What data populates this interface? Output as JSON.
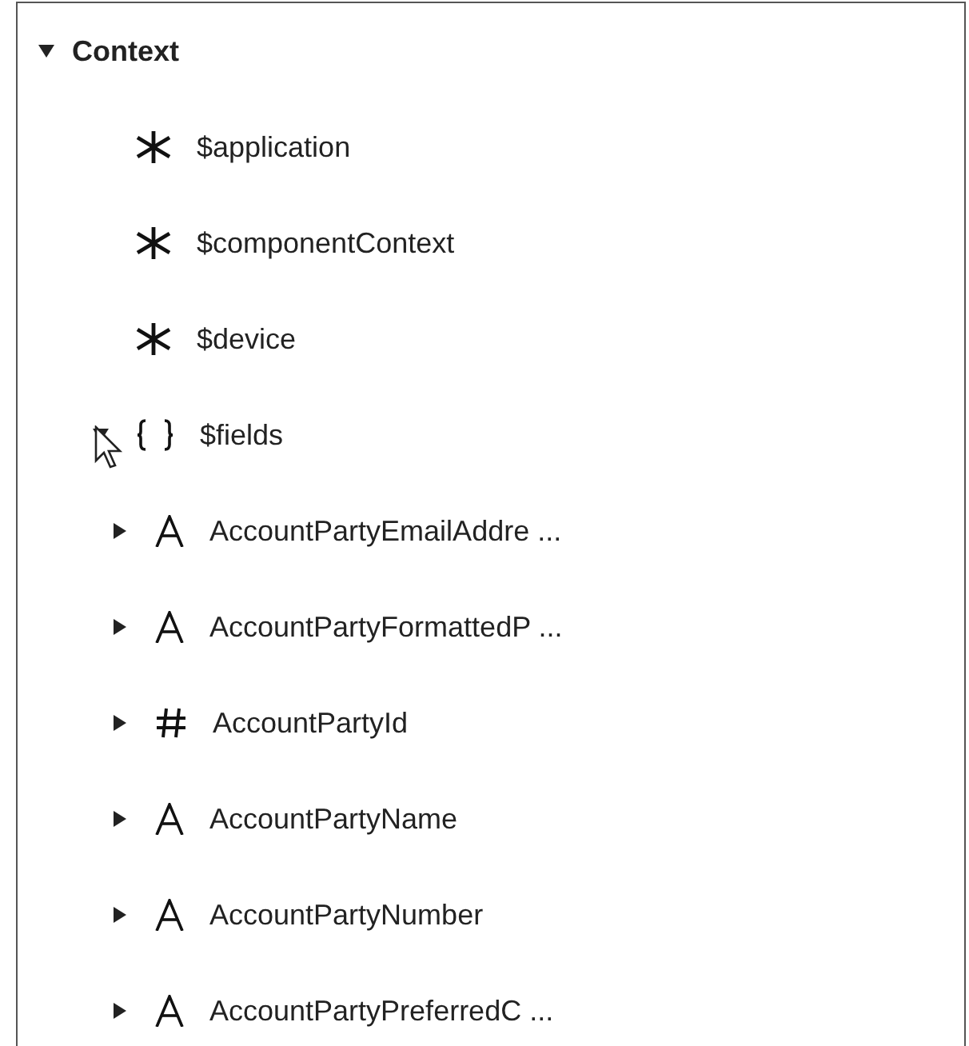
{
  "tree": [
    {
      "label": "Context",
      "kind": "group",
      "expanded": true,
      "children": [
        {
          "label": "$application",
          "kind": "variable"
        },
        {
          "label": "$componentContext",
          "kind": "variable"
        },
        {
          "label": "$device",
          "kind": "variable"
        },
        {
          "label": "$fields",
          "kind": "object",
          "expanded": true,
          "children": [
            {
              "label": "AccountPartyEmailAddre ...",
              "kind": "string",
              "expanded": false
            },
            {
              "label": "AccountPartyFormattedP ...",
              "kind": "string",
              "expanded": false
            },
            {
              "label": "AccountPartyId",
              "kind": "number",
              "expanded": false
            },
            {
              "label": "AccountPartyName",
              "kind": "string",
              "expanded": false
            },
            {
              "label": "AccountPartyNumber",
              "kind": "string",
              "expanded": false
            },
            {
              "label": "AccountPartyPreferredC ...",
              "kind": "string",
              "expanded": false
            }
          ]
        }
      ]
    }
  ]
}
